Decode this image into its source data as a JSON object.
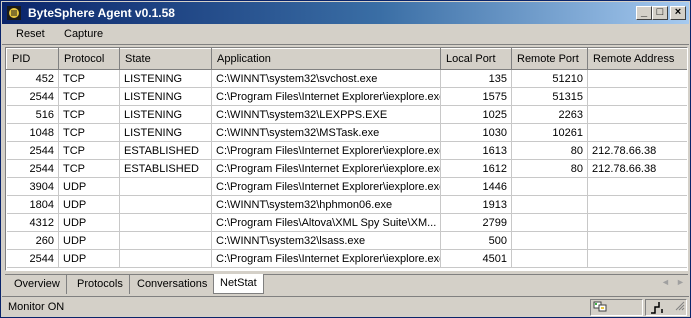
{
  "window": {
    "title": "ByteSphere Agent v0.1.58",
    "accent": "#0a246a"
  },
  "titlebar_buttons": {
    "minimize": "_",
    "maximize": "□",
    "close": "×"
  },
  "menu": {
    "reset_label": "Reset",
    "capture_label": "Capture"
  },
  "table": {
    "columns": [
      "PID",
      "Protocol",
      "State",
      "Application",
      "Local Port",
      "Remote Port",
      "Remote Address"
    ],
    "rows": [
      [
        "452",
        "TCP",
        "LISTENING",
        "C:\\WINNT\\system32\\svchost.exe",
        "135",
        "51210",
        ""
      ],
      [
        "2544",
        "TCP",
        "LISTENING",
        "C:\\Program Files\\Internet Explorer\\iexplore.exe",
        "1575",
        "51315",
        ""
      ],
      [
        "516",
        "TCP",
        "LISTENING",
        "C:\\WINNT\\system32\\LEXPPS.EXE",
        "1025",
        "2263",
        ""
      ],
      [
        "1048",
        "TCP",
        "LISTENING",
        "C:\\WINNT\\system32\\MSTask.exe",
        "1030",
        "10261",
        ""
      ],
      [
        "2544",
        "TCP",
        "ESTABLISHED",
        "C:\\Program Files\\Internet Explorer\\iexplore.exe",
        "1613",
        "80",
        "212.78.66.38"
      ],
      [
        "2544",
        "TCP",
        "ESTABLISHED",
        "C:\\Program Files\\Internet Explorer\\iexplore.exe",
        "1612",
        "80",
        "212.78.66.38"
      ],
      [
        "3904",
        "UDP",
        "",
        "C:\\Program Files\\Internet Explorer\\iexplore.exe",
        "1446",
        "",
        ""
      ],
      [
        "1804",
        "UDP",
        "",
        "C:\\WINNT\\system32\\hphmon06.exe",
        "1913",
        "",
        ""
      ],
      [
        "4312",
        "UDP",
        "",
        "C:\\Program Files\\Altova\\XML Spy Suite\\XM...",
        "2799",
        "",
        ""
      ],
      [
        "260",
        "UDP",
        "",
        "C:\\WINNT\\system32\\lsass.exe",
        "500",
        "",
        ""
      ],
      [
        "2544",
        "UDP",
        "",
        "C:\\Program Files\\Internet Explorer\\iexplore.exe",
        "4501",
        "",
        ""
      ]
    ]
  },
  "tabs": [
    "Overview",
    "Protocols",
    "Conversations",
    "NetStat"
  ],
  "active_tab": "NetStat",
  "status": {
    "text": "Monitor ON"
  },
  "icons": {
    "app": "bytesphere-app-icon",
    "tab_left": "◄",
    "tab_right": "►"
  }
}
